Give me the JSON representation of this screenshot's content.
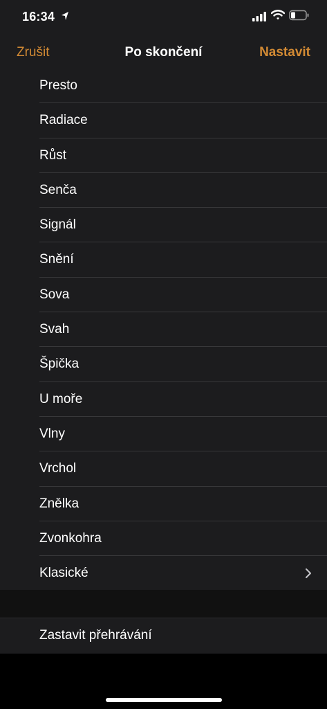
{
  "status": {
    "time": "16:34"
  },
  "nav": {
    "cancel_label": "Zrušit",
    "title": "Po skončení",
    "set_label": "Nastavit"
  },
  "colors": {
    "accent": "#d28a34",
    "background": "#1c1c1e"
  },
  "list": {
    "items": [
      {
        "label": "Presto"
      },
      {
        "label": "Radiace"
      },
      {
        "label": "Růst"
      },
      {
        "label": "Senča"
      },
      {
        "label": "Signál"
      },
      {
        "label": "Snění"
      },
      {
        "label": "Sova"
      },
      {
        "label": "Svah"
      },
      {
        "label": "Špička"
      },
      {
        "label": "U moře"
      },
      {
        "label": "Vlny"
      },
      {
        "label": "Vrchol"
      },
      {
        "label": "Znělka"
      },
      {
        "label": "Zvonkohra"
      },
      {
        "label": "Klasické",
        "icon": "chevron-right-icon"
      }
    ]
  },
  "stop": {
    "label": "Zastavit přehrávání"
  }
}
